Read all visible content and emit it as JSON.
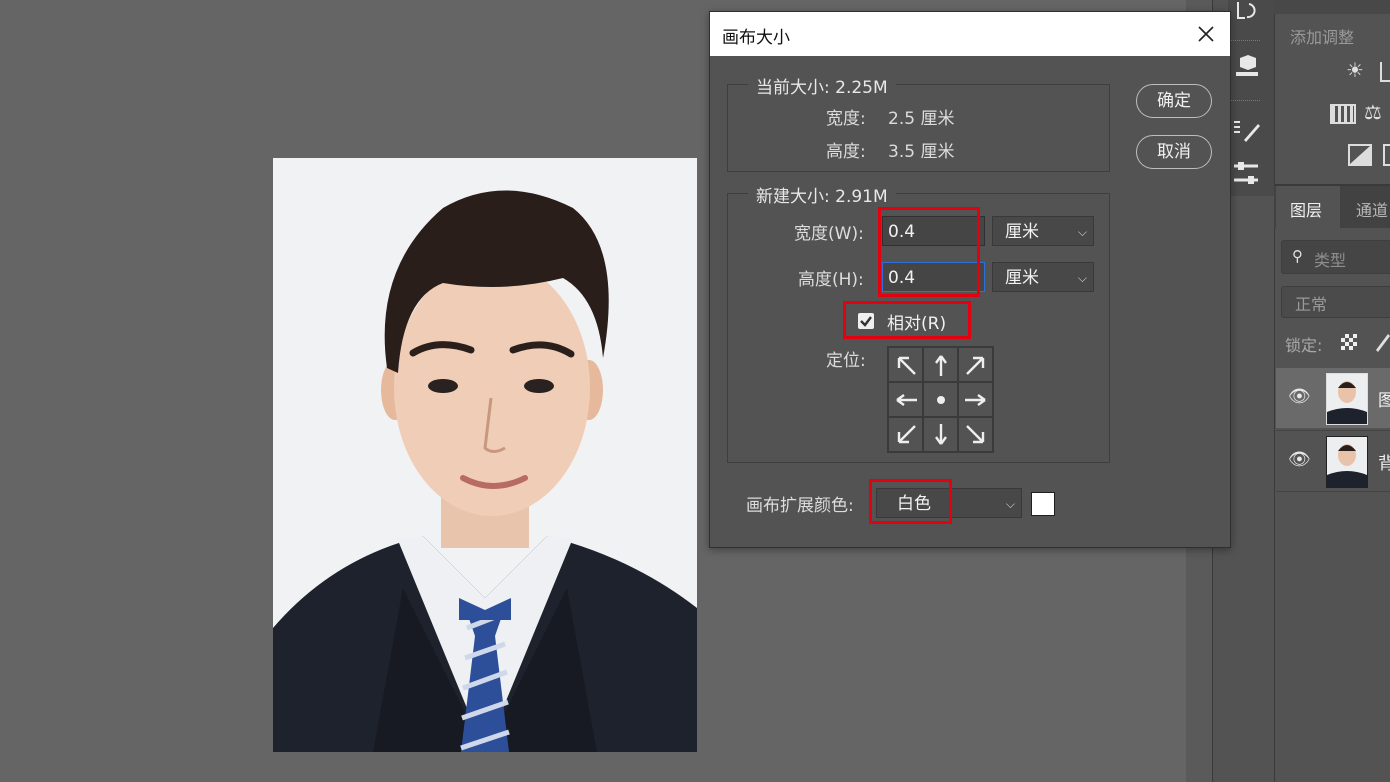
{
  "dialog": {
    "title": "画布大小",
    "current": {
      "legend": "当前大小: 2.25M",
      "width_label": "宽度:",
      "width_value": "2.5 厘米",
      "height_label": "高度:",
      "height_value": "3.5 厘米"
    },
    "new": {
      "legend": "新建大小: 2.91M",
      "width_label": "宽度(W):",
      "width_value": "0.4",
      "width_unit": "厘米",
      "height_label": "高度(H):",
      "height_value": "0.4",
      "height_unit": "厘米",
      "relative_label": "相对(R)",
      "relative_checked": true,
      "anchor_label": "定位:"
    },
    "canvas_ext": {
      "label": "画布扩展颜色:",
      "value": "白色",
      "swatch_color": "#ffffff"
    },
    "ok_button": "确定",
    "cancel_button": "取消"
  },
  "right_panel": {
    "adjust_title": "添加调整",
    "tabs": [
      "图层",
      "通道"
    ],
    "search_placeholder": "类型",
    "blend_mode": "正常",
    "lock_label": "锁定:",
    "layers": [
      {
        "name": "图",
        "active": true
      },
      {
        "name": "背",
        "active": false
      }
    ]
  },
  "colors": {
    "highlight": "#e3000f",
    "canvas_bg": "#656565",
    "dialog_bg": "#535353"
  }
}
